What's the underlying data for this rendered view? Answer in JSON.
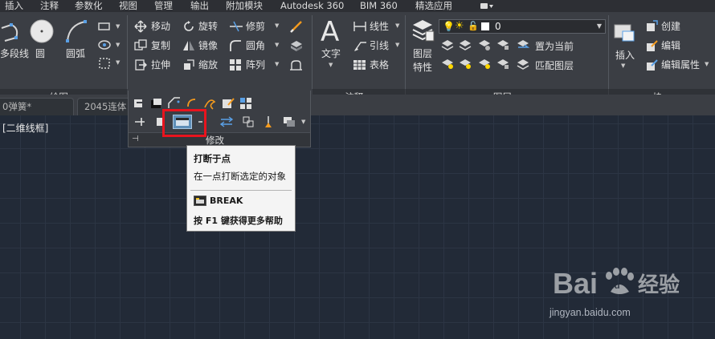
{
  "menubar": {
    "items": [
      "插入",
      "注释",
      "参数化",
      "视图",
      "管理",
      "输出",
      "附加模块",
      "Autodesk 360",
      "BIM 360",
      "精选应用"
    ]
  },
  "draw_panel": {
    "footer": "绘图",
    "buttons": [
      "多段线",
      "圆",
      "圆弧"
    ]
  },
  "modify_panel": {
    "footer": "修改",
    "rows": [
      [
        "移动",
        "旋转",
        "修剪"
      ],
      [
        "复制",
        "镜像",
        "圆角"
      ],
      [
        "拉伸",
        "缩放",
        "阵列"
      ]
    ]
  },
  "annotation_panel": {
    "footer": "注释",
    "text_button": "文字",
    "items": [
      "线性",
      "引线",
      "表格"
    ]
  },
  "layers_panel": {
    "footer": "图层",
    "properties_button": [
      "图层",
      "特性"
    ],
    "layer_value": "0",
    "actions": [
      "置为当前",
      "匹配图层"
    ]
  },
  "block_panel": {
    "footer": "块",
    "insert_button": "插入",
    "items": [
      "创建",
      "编辑",
      "编辑属性"
    ]
  },
  "doc_tabs": [
    "0弹簧*",
    "2045连体"
  ],
  "viewport_label": "[二维线框]",
  "tooltip": {
    "title": "打断于点",
    "description": "在一点打断选定的对象",
    "command": "BREAK",
    "help_prefix": "按",
    "help_key": "F1",
    "help_suffix": "键获得更多帮助"
  },
  "watermark": {
    "logo_text": [
      "Bai",
      "du",
      "经验"
    ],
    "domain": "jingyan.baidu.com"
  },
  "colors": {
    "canvas": "#222a37",
    "ribbon": "#3b3e44",
    "highlight": "#e8141e",
    "tooltip_bg": "#f4f4f4"
  }
}
